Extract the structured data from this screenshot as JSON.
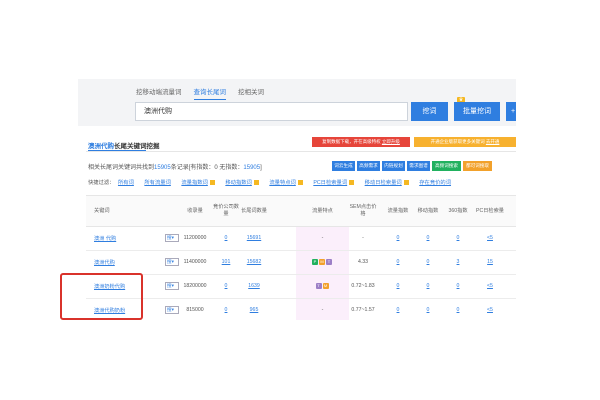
{
  "tabs": [
    {
      "label": "挖移动端流量词"
    },
    {
      "label": "查询长尾词"
    },
    {
      "label": "挖相关词"
    }
  ],
  "search": {
    "value": "澳洲代购"
  },
  "buttons": {
    "dig": "挖词",
    "batch": "批量挖词",
    "plus": "+"
  },
  "section": {
    "title_highlight": "澳洲代购",
    "title_rest": "长尾关键词挖掘"
  },
  "notices": {
    "red_text": "复制数据下载，开在高级特权 ",
    "red_link": "立即升级",
    "orange_text": "开通企业版获取更多关键词 ",
    "orange_link": "去开通"
  },
  "summary": {
    "prefix": "相关长尾词关键词共找到",
    "total": "15905",
    "middle": "条记录[有指数：",
    "with_index": "0",
    "mid2": "  无指数：",
    "without_index": "15905",
    "suffix": "]"
  },
  "action_buttons": [
    {
      "label": "词云生成",
      "color": "blue"
    },
    {
      "label": "高频需求",
      "color": "blue"
    },
    {
      "label": "内链规划",
      "color": "blue"
    },
    {
      "label": "需求图谱",
      "color": "blue"
    },
    {
      "label": "高频词搜索",
      "color": "green"
    },
    {
      "label": "都可词搜取",
      "color": "orange"
    }
  ],
  "filters": {
    "label": "快捷过滤：",
    "items": [
      "所有词",
      "所有流量词",
      "流量指数词",
      "移动指数词",
      "流量特点词",
      "PC日检索量词",
      "移动日检索量词",
      "存在竞价的词"
    ]
  },
  "columns": [
    "关键词",
    "收录量",
    "竞价公司数量",
    "长尾词数量",
    "流量特点",
    "SEM点击价格",
    "流量指数",
    "移动指数",
    "360指数",
    "PC日检索量"
  ],
  "rows": [
    {
      "keyword": "澳洲 代购",
      "select": "搜",
      "indexed": "11200000",
      "bid": "0",
      "longtail": "15691",
      "traits": [],
      "traits_text": "-",
      "sem": "-",
      "flow": "0",
      "mobile": "0",
      "s360": "0",
      "pc": "<5"
    },
    {
      "keyword": "澳洲代购",
      "select": "搜",
      "indexed": "11400000",
      "bid": "101",
      "longtail": "15682",
      "traits": [
        "g",
        "o",
        "p"
      ],
      "traits_text": "",
      "sem": "4.33",
      "flow": "0",
      "mobile": "0",
      "s360": "3",
      "pc": "15"
    },
    {
      "keyword": "澳洲奶粉代购",
      "select": "搜",
      "indexed": "18200000",
      "bid": "0",
      "longtail": "1639",
      "traits": [
        "p",
        "o"
      ],
      "traits_text": "",
      "sem": "0.72~1.83",
      "flow": "0",
      "mobile": "0",
      "s360": "0",
      "pc": "<5"
    },
    {
      "keyword": "澳洲代购奶粉",
      "select": "搜",
      "indexed": "815000",
      "bid": "0",
      "longtail": "965",
      "traits": [],
      "traits_text": "-",
      "sem": "0.77~1.57",
      "flow": "0",
      "mobile": "0",
      "s360": "0",
      "pc": "<5"
    }
  ],
  "colors": {
    "accent": "#2f7ee0",
    "red": "#e6453a",
    "orange": "#f7b12f",
    "green": "#21b15f",
    "highlight_box": "#d9322b"
  }
}
